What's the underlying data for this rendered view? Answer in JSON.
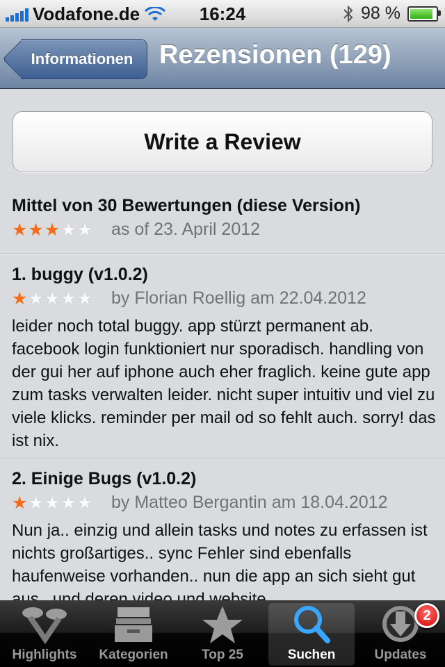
{
  "status_bar": {
    "carrier": "Vodafone.de",
    "time": "16:24",
    "battery": "98 %",
    "battery_level": 0.98
  },
  "nav": {
    "back_label": "Informationen",
    "title": "Rezensionen (129)"
  },
  "write_review_label": "Write a Review",
  "summary": {
    "title": "Mittel von 30 Bewertungen (diese Version)",
    "rating_stars": 3,
    "stars_text": "★★★★★",
    "date": "as of 23. April 2012"
  },
  "reviews": [
    {
      "title": "1. buggy (v1.0.2)",
      "rating_stars": 1,
      "stars_text": "★★★★★",
      "byline": "by Florian Roellig am 22.04.2012",
      "text": "leider noch total buggy. app stürzt permanent ab. facebook login funktioniert nur sporadisch. handling von der gui her auf iphone auch eher fraglich. keine gute app zum tasks verwalten leider. nicht super intuitiv und viel zu viele klicks. reminder per mail od so fehlt auch. sorry! das ist nix."
    },
    {
      "title": "2. Einige Bugs (v1.0.2)",
      "rating_stars": 1,
      "stars_text": "★★★★★",
      "byline": "by Matteo Bergantin am 18.04.2012",
      "text": "Nun ja.. einzig und allein tasks und notes zu erfassen ist nichts großartiges.. sync Fehler sind ebenfalls haufenweise vorhanden.. nun die app an sich sieht gut aus.. und deren video und website"
    }
  ],
  "tab_bar": {
    "tabs": [
      {
        "label": "Highlights",
        "icon": "highlights-icon"
      },
      {
        "label": "Kategorien",
        "icon": "categories-icon"
      },
      {
        "label": "Top 25",
        "icon": "star-icon"
      },
      {
        "label": "Suchen",
        "icon": "search-icon",
        "active": true
      },
      {
        "label": "Updates",
        "icon": "updates-icon",
        "badge": "2"
      }
    ]
  },
  "colors": {
    "star_active": "#f56b1a",
    "nav_bar": "#6d84a2",
    "badge": "#d60000",
    "active_tab_icon": "#3aa7ff"
  }
}
